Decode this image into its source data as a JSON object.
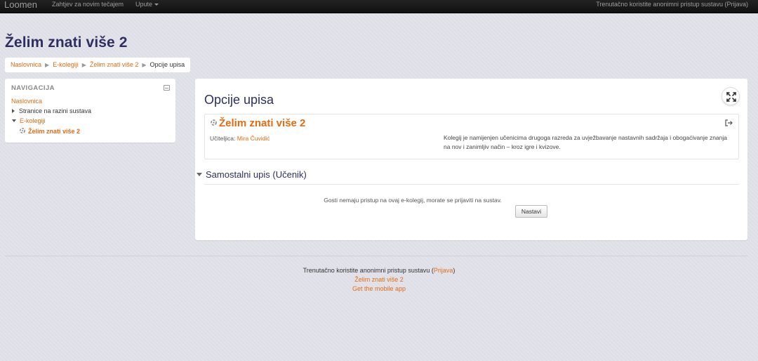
{
  "navbar": {
    "brand": "Loomen",
    "links": [
      "Zahtjev za novim tečajem",
      "Upute"
    ],
    "login_info": "Trenutačno koristite anonimni pristup sustavu (Prijava)"
  },
  "page": {
    "heading": "Želim znati više 2"
  },
  "breadcrumb": {
    "items": [
      "Naslovnica",
      "E-kolegiji",
      "Želim znati više 2"
    ],
    "current": "Opcije upisa"
  },
  "nav_block": {
    "title": "NAVIGACIJA",
    "home": "Naslovnica",
    "site_pages": "Stranice na razini sustava",
    "courses": "E-kolegiji",
    "current_course": "Želim znati više 2"
  },
  "main": {
    "title": "Opcije upisa",
    "course": {
      "name": "Želim znati više 2",
      "teacher_label": "Učiteljica:",
      "teacher_name": "Mira Čuvidić",
      "summary": "Kolegij je namijenjen učenicima drugoga razreda za uvježbavanje nastavnih sadržaja i obogaćivanje znanja na nov i zanimljiv način – kroz igre i kvizove."
    },
    "section_title": "Samostalni upis (Učenik)",
    "guest_message": "Gosti nemaju pristup na ovaj e-kolegij, morate se prijaviti na sustav.",
    "continue_button": "Nastavi"
  },
  "footer": {
    "login_prefix": "Trenutačno koristite anonimni pristup sustavu (",
    "login_link": "Prijava",
    "login_suffix": ")",
    "course_link": "Želim znati više 2",
    "app_link": "Get the mobile app"
  },
  "colors": {
    "accent": "#e56b12",
    "heading": "#2e2f5e",
    "navbar": "#1a1a1a",
    "page_bg": "#e2e3ea"
  }
}
